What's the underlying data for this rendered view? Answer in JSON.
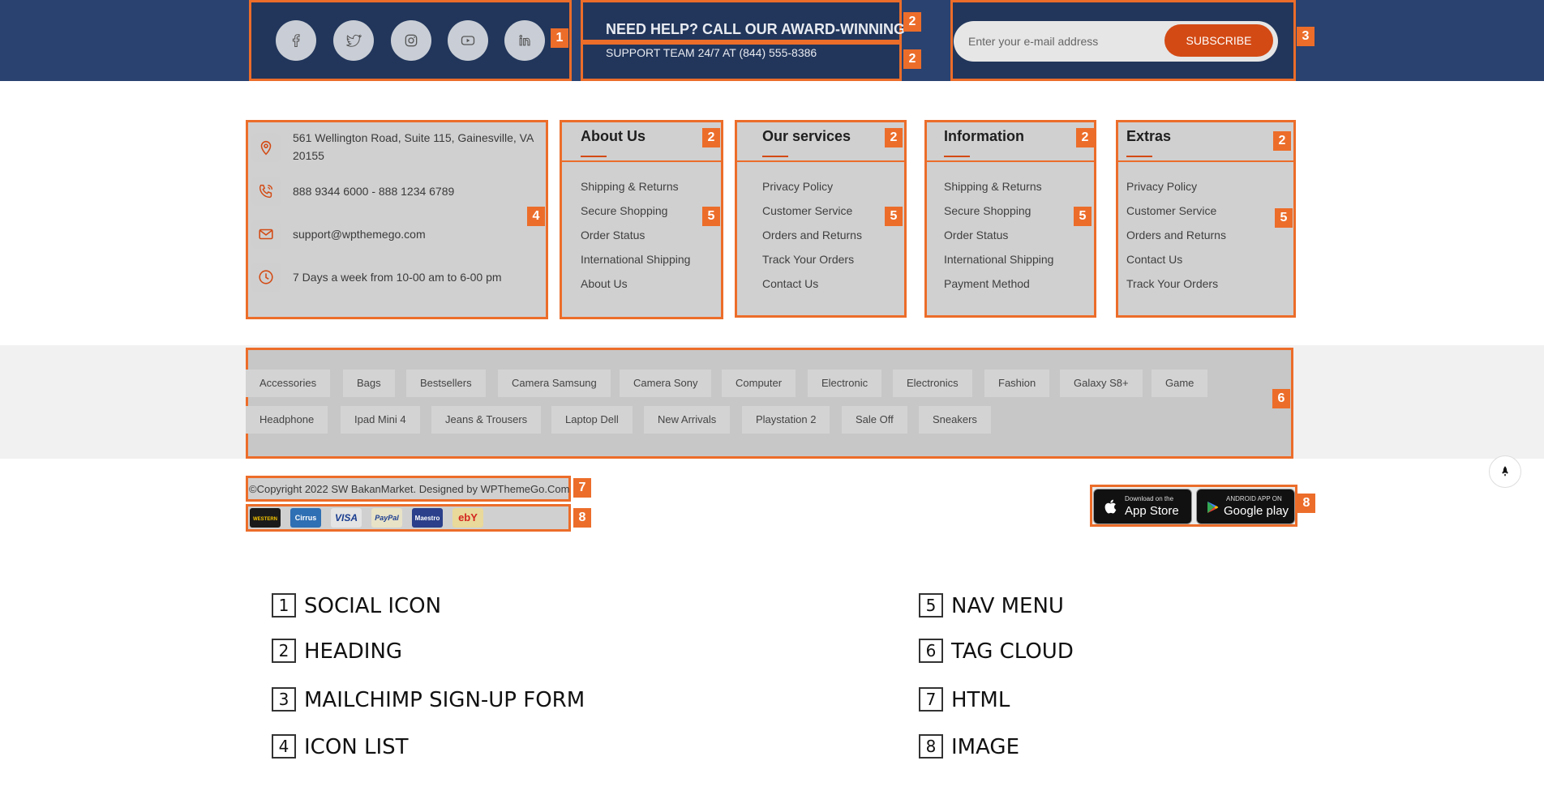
{
  "social": {
    "icons": [
      "facebook-icon",
      "twitter-icon",
      "instagram-icon",
      "youtube-icon",
      "linkedin-icon"
    ]
  },
  "help": {
    "line1": "NEED HELP? CALL OUR AWARD-WINNING",
    "line2": "SUPPORT TEAM 24/7 AT (844) 555-8386"
  },
  "newsletter": {
    "placeholder": "Enter your e-mail address",
    "button": "SUBSCRIBE"
  },
  "contact": {
    "address": "561 Wellington Road, Suite 115, Gainesville, VA 20155",
    "phone": "888 9344 6000 - 888 1234 6789",
    "email": "support@wpthemego.com",
    "hours": "7 Days a week from 10-00 am to 6-00 pm"
  },
  "columns": [
    {
      "title": "About Us",
      "links": [
        "Shipping & Returns",
        "Secure Shopping",
        "Order Status",
        "International Shipping",
        "About Us"
      ]
    },
    {
      "title": "Our services",
      "links": [
        "Privacy Policy",
        "Customer Service",
        "Orders and Returns",
        "Track Your Orders",
        "Contact Us"
      ]
    },
    {
      "title": "Information",
      "links": [
        "Shipping & Returns",
        "Secure Shopping",
        "Order Status",
        "International Shipping",
        "Payment Method"
      ]
    },
    {
      "title": "Extras",
      "links": [
        "Privacy Policy",
        "Customer Service",
        "Orders and Returns",
        "Contact Us",
        "Track Your Orders"
      ]
    }
  ],
  "tags": {
    "row1": [
      "Accessories",
      "Bags",
      "Bestsellers",
      "Camera Samsung",
      "Camera Sony",
      "Computer",
      "Electronic",
      "Electronics",
      "Fashion",
      "Galaxy S8+",
      "Game"
    ],
    "row2": [
      "Headphone",
      "Ipad Mini 4",
      "Jeans & Trousers",
      "Laptop Dell",
      "New Arrivals",
      "Playstation 2",
      "Sale Off",
      "Sneakers"
    ]
  },
  "copyright": "©Copyright 2022 SW BakanMarket. Designed by WPThemeGo.Com",
  "payments": [
    {
      "label": "WESTERN UNION",
      "color": "#1a1a1a",
      "fg": "#f7c600"
    },
    {
      "label": "Cirrus",
      "color": "#2f6fb3",
      "fg": "#ffffff"
    },
    {
      "label": "VISA",
      "color": "#e4e4e4",
      "fg": "#1a3d8f"
    },
    {
      "label": "PayPal",
      "color": "#e8e2c7",
      "fg": "#1a3d8f"
    },
    {
      "label": "Maestro",
      "color": "#2b3f8a",
      "fg": "#ffffff"
    },
    {
      "label": "ebY",
      "color": "#e9d99a",
      "fg": "#d3261f"
    }
  ],
  "stores": {
    "apple_small": "Download on the",
    "apple_big": "App Store",
    "google_small": "ANDROID APP ON",
    "google_big": "Google play"
  },
  "badges": {
    "social": "1",
    "heading": "2",
    "mailchimp": "3",
    "iconlist": "4",
    "navmenu": "5",
    "tagcloud": "6",
    "html": "7",
    "image": "8"
  },
  "legend": {
    "items": [
      {
        "num": "1",
        "label": "SOCIAL ICON"
      },
      {
        "num": "2",
        "label": "HEADING"
      },
      {
        "num": "3",
        "label": "MAILCHIMP SIGN-UP FORM"
      },
      {
        "num": "4",
        "label": "ICON LIST"
      },
      {
        "num": "5",
        "label": "NAV MENU"
      },
      {
        "num": "6",
        "label": "TAG CLOUD"
      },
      {
        "num": "7",
        "label": "HTML"
      },
      {
        "num": "8",
        "label": "IMAGE"
      }
    ]
  },
  "colors": {
    "top_band": "#2a4270",
    "accent": "#ec6d2a",
    "subscribe": "#d34a14"
  }
}
